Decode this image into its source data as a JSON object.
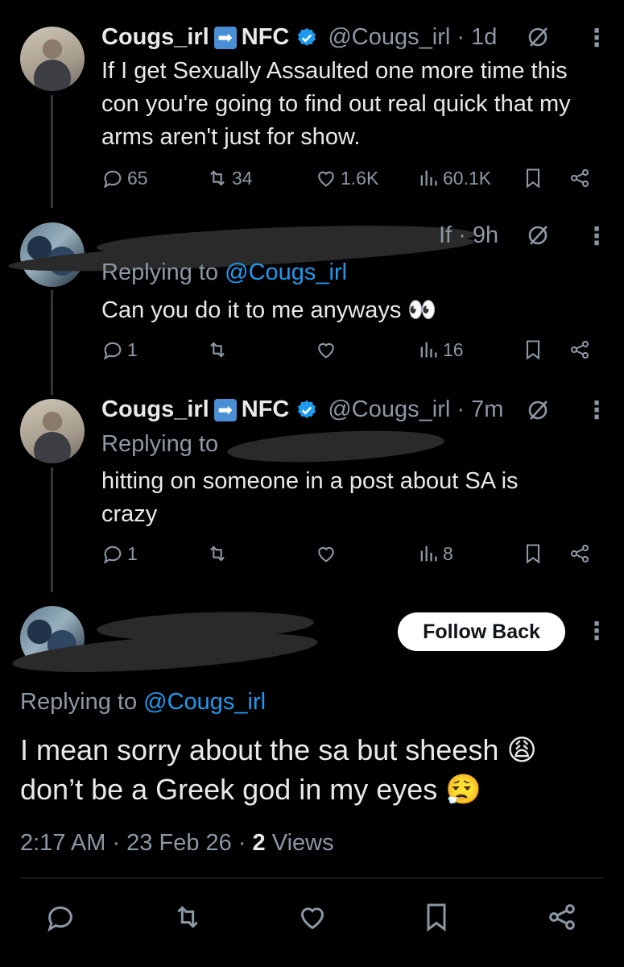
{
  "tweet1": {
    "name": "Cougs_irl",
    "arrow_icon": "➡",
    "tag": "NFC",
    "handle": "@Cougs_irl · 1d",
    "text": "If I get Sexually Assaulted one more time this con you're going to find out real quick that my arms aren't just for show.",
    "replies": "65",
    "reposts": "34",
    "likes": "1.6K",
    "views": "60.1K"
  },
  "tweet2": {
    "name_fragment": "If · 9h",
    "replying_label": "Replying to",
    "replying_to": "@Cougs_irl",
    "text": "Can you do it to me anyways",
    "emoji": "👀",
    "replies": "1",
    "views": "16"
  },
  "tweet3": {
    "name": "Cougs_irl",
    "arrow_icon": "➡",
    "tag": "NFC",
    "handle": "@Cougs_irl · 7m",
    "replying_label": "Replying to",
    "text": "hitting on someone in a post about SA is crazy",
    "replies": "1",
    "views": "8"
  },
  "main_tweet": {
    "follow_button": "Follow Back",
    "replying_label": "Replying to",
    "replying_to": "@Cougs_irl",
    "text_line1": "I mean sorry about the sa but sheesh",
    "emoji1": "😩",
    "text_line2": "don’t be a Greek god in my eyes",
    "emoji2": "😮‍💨",
    "time": "2:17 AM · 23 Feb 26 · ",
    "views_count": "2",
    "views_label": " Views"
  },
  "icons": {
    "more": "⋮",
    "accent": "#1d9bf0"
  }
}
